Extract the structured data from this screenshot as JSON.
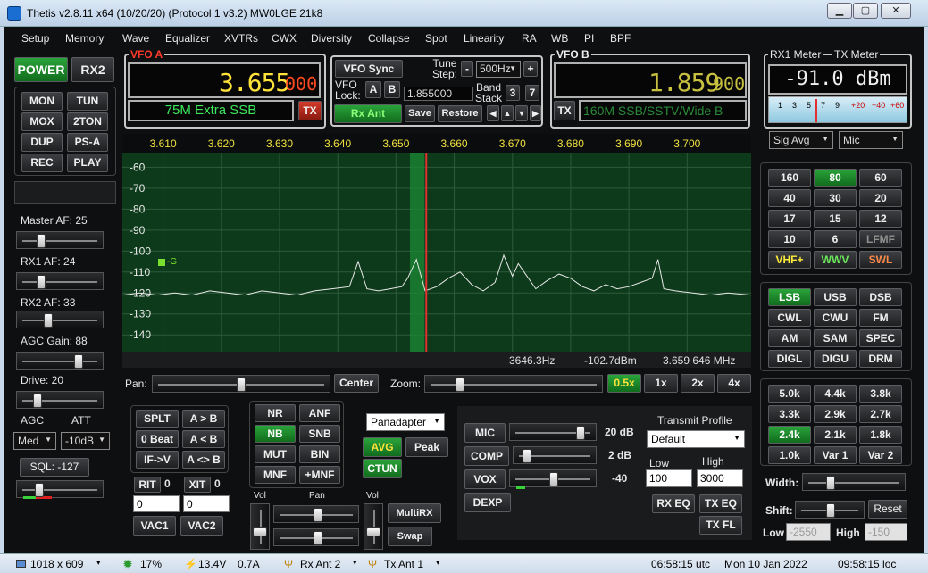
{
  "window": {
    "title": "Thetis v2.8.11 x64 (10/20/20) (Protocol 1 v3.2) MW0LGE 21k8",
    "min": "▁",
    "max": "▢",
    "close": "✕"
  },
  "menu": [
    "Setup",
    "Memory",
    "Wave",
    "Equalizer",
    "XVTRs",
    "CWX",
    "Diversity",
    "Collapse",
    "Spot",
    "Linearity",
    "RA",
    "WB",
    "PI",
    "BPF"
  ],
  "left": {
    "power": "POWER",
    "rx2": "RX2",
    "buttons": [
      "MON",
      "TUN",
      "MOX",
      "2TON",
      "DUP",
      "PS-A",
      "REC",
      "PLAY"
    ],
    "master_af": "Master AF:  25",
    "rx1_af": "RX1 AF:  24",
    "rx2_af": "RX2 AF:  33",
    "agc_gain": "AGC Gain:  88",
    "drive": "Drive:  20",
    "agc_label": "AGC",
    "att_label": "ATT",
    "agc_value": "Med",
    "att_value": "-10dB",
    "sql": "SQL:  -127"
  },
  "vfo_a": {
    "label": "VFO A",
    "freq_main": "3.655",
    "freq_sub": "000",
    "band": "75M Extra SSB",
    "tx": "TX"
  },
  "vfo_mid": {
    "sync": "VFO Sync",
    "tune_step_label": "Tune Step:",
    "tune_step": "500Hz",
    "minus": "-",
    "plus": "+",
    "lock_label": "VFO Lock:",
    "a": "A",
    "b": "B",
    "lock_value": "1.855000",
    "band_stack": "Band Stack",
    "bs3": "3",
    "bs7": "7",
    "rx_ant": "Rx Ant",
    "save": "Save",
    "restore": "Restore"
  },
  "vfo_b": {
    "label": "VFO B",
    "freq_main": "1.859",
    "freq_sub": "900",
    "tx": "TX",
    "band": "160M SSB/SSTV/Wide B"
  },
  "meter": {
    "rx1_label": "RX1 Meter",
    "tx_label": "TX Meter",
    "reading": "-91.0 dBm",
    "scale": [
      "1",
      "3",
      "5",
      "7",
      "9",
      "+20",
      "+40",
      "+60"
    ],
    "rx_mode": "Sig Avg",
    "tx_mode": "Mic"
  },
  "spectrum": {
    "freq_ticks": [
      "3.610",
      "3.620",
      "3.630",
      "3.640",
      "3.650",
      "3.660",
      "3.670",
      "3.680",
      "3.690",
      "3.700"
    ],
    "db_ticks": [
      "-60",
      "-70",
      "-80",
      "-90",
      "-100",
      "-110",
      "-120",
      "-130",
      "-140"
    ],
    "readout_hz": "3646.3Hz",
    "readout_dbm": "-102.7dBm",
    "readout_mhz": "3.659 646 MHz",
    "marker": "-G"
  },
  "pan": {
    "label": "Pan:",
    "center": "Center",
    "zoom_label": "Zoom:",
    "zooms": [
      "0.5x",
      "1x",
      "2x",
      "4x"
    ]
  },
  "bands": [
    "160",
    "80",
    "60",
    "40",
    "30",
    "20",
    "17",
    "15",
    "12",
    "10",
    "6",
    "LFMF",
    "VHF+",
    "WWV",
    "SWL"
  ],
  "modes": [
    "LSB",
    "USB",
    "DSB",
    "CWL",
    "CWU",
    "FM",
    "AM",
    "SAM",
    "SPEC",
    "DIGL",
    "DIGU",
    "DRM"
  ],
  "filters": [
    "5.0k",
    "4.4k",
    "3.8k",
    "3.3k",
    "2.9k",
    "2.7k",
    "2.4k",
    "2.1k",
    "1.8k",
    "1.0k",
    "Var 1",
    "Var 2"
  ],
  "filter_ctrl": {
    "width": "Width:",
    "shift": "Shift:",
    "reset": "Reset",
    "low": "Low",
    "low_val": "-2550",
    "high": "High",
    "high_val": "-150"
  },
  "rx_ctrl": {
    "split": "SPLT",
    "a_to_b": "A > B",
    "zero_beat": "0 Beat",
    "a_from_b": "A < B",
    "if_v": "IF->V",
    "a_swap_b": "A <> B",
    "rit": "RIT",
    "rit_v": "0",
    "xit": "XIT",
    "xit_v": "0",
    "rit_val": "0",
    "xit_val": "0",
    "vac1": "VAC1",
    "vac2": "VAC2"
  },
  "dsp": {
    "nr": "NR",
    "anf": "ANF",
    "nb": "NB",
    "snb": "SNB",
    "mut": "MUT",
    "bin": "BIN",
    "mnf": "MNF",
    "pmnf": "+MNF",
    "display": "Panadapter",
    "avg": "AVG",
    "peak": "Peak",
    "ctun": "CTUN"
  },
  "mix": {
    "vol": "Vol",
    "pan": "Pan",
    "vol2": "Vol",
    "multirx": "MultiRX",
    "swap": "Swap"
  },
  "tx": {
    "mic": "MIC",
    "mic_val": "20 dB",
    "comp": "COMP",
    "comp_val": "2 dB",
    "vox": "VOX",
    "vox_val": "-40",
    "dexp": "DEXP",
    "profile_label": "Transmit Profile",
    "profile": "Default",
    "low": "Low",
    "high": "High",
    "low_val": "100",
    "high_val": "3000",
    "rx_eq": "RX EQ",
    "tx_eq": "TX EQ",
    "tx_fl": "TX FL"
  },
  "status": {
    "size": "1018 x 609",
    "cpu": "17%",
    "volt": "13.4V",
    "amp": "0.7A",
    "rx_ant": "Rx Ant 2",
    "tx_ant": "Tx Ant 1",
    "utc": "06:58:15 utc",
    "date": "Mon 10 Jan 2022",
    "loc": "09:58:15 loc"
  },
  "colors": {
    "green_on": "#1f8f2c",
    "vfo_a": "#ffe23a",
    "vfo_a_sub": "#ff4a20",
    "vfo_b": "#c8c040",
    "band_text": "#3de85a",
    "spectrum_bg": "#0d3a1a"
  },
  "chart_data": {
    "type": "line",
    "xlabel": "",
    "ylabel": "",
    "xlim": [
      3.603,
      3.711
    ],
    "ylim": [
      -148,
      -53
    ],
    "x": [
      3.603,
      3.606,
      3.609,
      3.612,
      3.615,
      3.618,
      3.621,
      3.624,
      3.627,
      3.63,
      3.633,
      3.636,
      3.639,
      3.642,
      3.6435,
      3.645,
      3.647,
      3.649,
      3.651,
      3.652,
      3.6535,
      3.655,
      3.657,
      3.659,
      3.661,
      3.663,
      3.665,
      3.667,
      3.6685,
      3.67,
      3.671,
      3.672,
      3.674,
      3.676,
      3.678,
      3.68,
      3.682,
      3.684,
      3.686,
      3.688,
      3.69,
      3.692,
      3.694,
      3.695,
      3.696,
      3.698,
      3.701,
      3.704,
      3.707,
      3.711
    ],
    "values": [
      -121,
      -120,
      -121,
      -120,
      -121,
      -119,
      -120,
      -121,
      -119,
      -120,
      -121,
      -119,
      -118,
      -117,
      -105,
      -118,
      -119,
      -118,
      -117,
      -113,
      -104,
      -119,
      -117,
      -113,
      -110,
      -116,
      -119,
      -115,
      -102,
      -112,
      -106,
      -110,
      -118,
      -114,
      -111,
      -113,
      -117,
      -119,
      -116,
      -118,
      -117,
      -115,
      -113,
      -104,
      -118,
      -119,
      -120,
      -121,
      -120,
      -121
    ],
    "reference_db": -109
  }
}
